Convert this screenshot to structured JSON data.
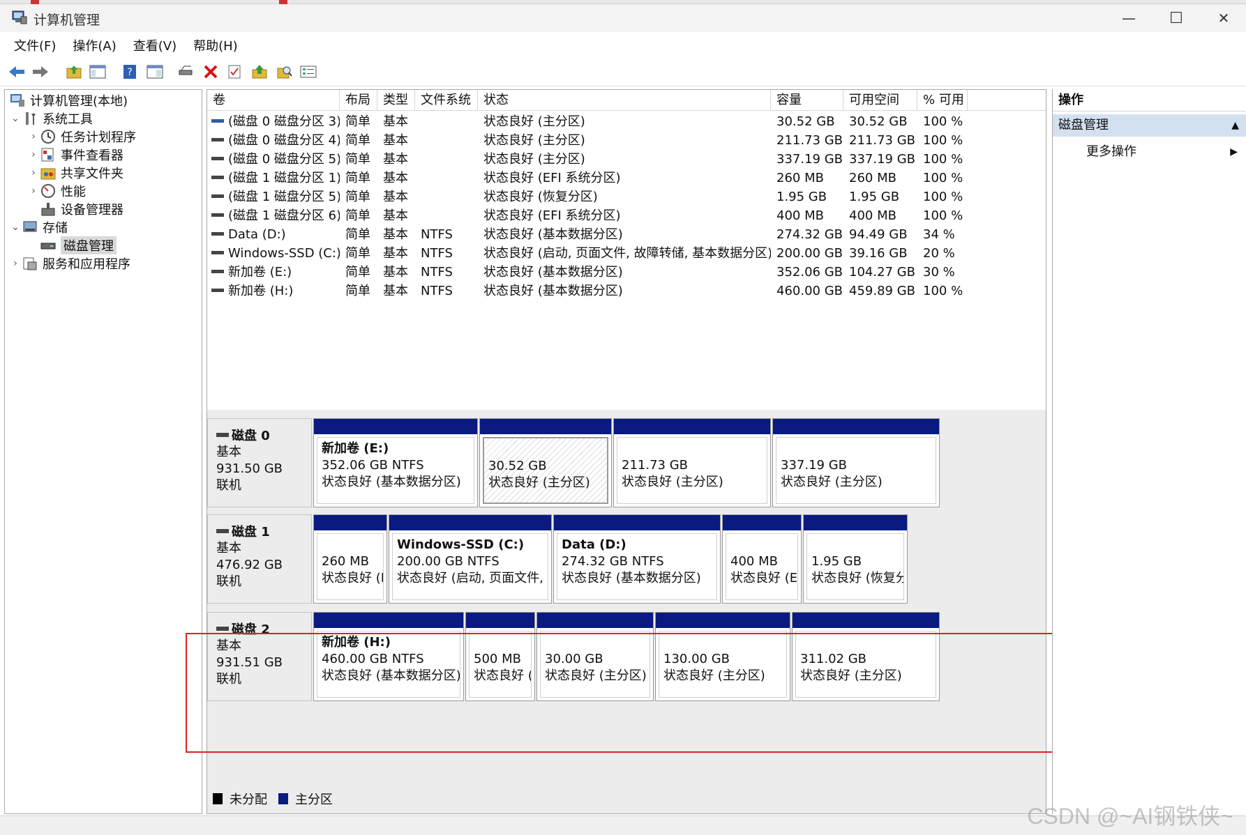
{
  "window": {
    "title": "计算机管理",
    "minimize": "—",
    "maximize": "☐",
    "close": "✕"
  },
  "menu": [
    "文件(F)",
    "操作(A)",
    "查看(V)",
    "帮助(H)"
  ],
  "tree": {
    "root": "计算机管理(本地)",
    "system_tools": "系统工具",
    "task_scheduler": "任务计划程序",
    "event_viewer": "事件查看器",
    "shared_folders": "共享文件夹",
    "performance": "性能",
    "device_manager": "设备管理器",
    "storage": "存储",
    "disk_management": "磁盘管理",
    "services_apps": "服务和应用程序"
  },
  "list": {
    "columns": [
      "卷",
      "布局",
      "类型",
      "文件系统",
      "状态",
      "容量",
      "可用空间",
      "% 可用"
    ],
    "rows": [
      {
        "vol": "(磁盘 0 磁盘分区 3)",
        "layout": "简单",
        "type": "基本",
        "fs": "",
        "status": "状态良好 (主分区)",
        "cap": "30.52 GB",
        "free": "30.52 GB",
        "pct": "100 %"
      },
      {
        "vol": "(磁盘 0 磁盘分区 4)",
        "layout": "简单",
        "type": "基本",
        "fs": "",
        "status": "状态良好 (主分区)",
        "cap": "211.73 GB",
        "free": "211.73 GB",
        "pct": "100 %"
      },
      {
        "vol": "(磁盘 0 磁盘分区 5)",
        "layout": "简单",
        "type": "基本",
        "fs": "",
        "status": "状态良好 (主分区)",
        "cap": "337.19 GB",
        "free": "337.19 GB",
        "pct": "100 %"
      },
      {
        "vol": "(磁盘 1 磁盘分区 1)",
        "layout": "简单",
        "type": "基本",
        "fs": "",
        "status": "状态良好 (EFI 系统分区)",
        "cap": "260 MB",
        "free": "260 MB",
        "pct": "100 %"
      },
      {
        "vol": "(磁盘 1 磁盘分区 5)",
        "layout": "简单",
        "type": "基本",
        "fs": "",
        "status": "状态良好 (恢复分区)",
        "cap": "1.95 GB",
        "free": "1.95 GB",
        "pct": "100 %"
      },
      {
        "vol": "(磁盘 1 磁盘分区 6)",
        "layout": "简单",
        "type": "基本",
        "fs": "",
        "status": "状态良好 (EFI 系统分区)",
        "cap": "400 MB",
        "free": "400 MB",
        "pct": "100 %"
      },
      {
        "vol": "Data (D:)",
        "layout": "简单",
        "type": "基本",
        "fs": "NTFS",
        "status": "状态良好 (基本数据分区)",
        "cap": "274.32 GB",
        "free": "94.49 GB",
        "pct": "34 %"
      },
      {
        "vol": "Windows-SSD (C:)",
        "layout": "简单",
        "type": "基本",
        "fs": "NTFS",
        "status": "状态良好 (启动, 页面文件, 故障转储, 基本数据分区)",
        "cap": "200.00 GB",
        "free": "39.16 GB",
        "pct": "20 %"
      },
      {
        "vol": "新加卷 (E:)",
        "layout": "简单",
        "type": "基本",
        "fs": "NTFS",
        "status": "状态良好 (基本数据分区)",
        "cap": "352.06 GB",
        "free": "104.27 GB",
        "pct": "30 %"
      },
      {
        "vol": "新加卷 (H:)",
        "layout": "简单",
        "type": "基本",
        "fs": "NTFS",
        "status": "状态良好 (基本数据分区)",
        "cap": "460.00 GB",
        "free": "459.89 GB",
        "pct": "100 %"
      }
    ]
  },
  "disks": [
    {
      "name": "磁盘 0",
      "type": "基本",
      "size": "931.50 GB",
      "state": "联机",
      "partitions": [
        {
          "name": "新加卷 (E:)",
          "line1": "352.06 GB NTFS",
          "line2": "状态良好 (基本数据分区)"
        },
        {
          "name": "",
          "line1": "30.52 GB",
          "line2": "状态良好 (主分区)"
        },
        {
          "name": "",
          "line1": "211.73 GB",
          "line2": "状态良好 (主分区)"
        },
        {
          "name": "",
          "line1": "337.19 GB",
          "line2": "状态良好 (主分区)"
        }
      ]
    },
    {
      "name": "磁盘 1",
      "type": "基本",
      "size": "476.92 GB",
      "state": "联机",
      "partitions": [
        {
          "name": "",
          "line1": "260 MB",
          "line2": "状态良好 (EF"
        },
        {
          "name": "Windows-SSD (C:)",
          "line1": "200.00 GB NTFS",
          "line2": "状态良好 (启动, 页面文件, 故障"
        },
        {
          "name": "Data (D:)",
          "line1": "274.32 GB NTFS",
          "line2": "状态良好 (基本数据分区)"
        },
        {
          "name": "",
          "line1": "400 MB",
          "line2": "状态良好 (EFI"
        },
        {
          "name": "",
          "line1": "1.95 GB",
          "line2": "状态良好 (恢复分区"
        }
      ]
    },
    {
      "name": "磁盘 2",
      "type": "基本",
      "size": "931.51 GB",
      "state": "联机",
      "partitions": [
        {
          "name": "新加卷 (H:)",
          "line1": "460.00 GB NTFS",
          "line2": "状态良好 (基本数据分区)"
        },
        {
          "name": "",
          "line1": "500 MB",
          "line2": "状态良好 (E"
        },
        {
          "name": "",
          "line1": "30.00 GB",
          "line2": "状态良好 (主分区)"
        },
        {
          "name": "",
          "line1": "130.00 GB",
          "line2": "状态良好 (主分区)"
        },
        {
          "name": "",
          "line1": "311.02 GB",
          "line2": "状态良好 (主分区)"
        }
      ]
    }
  ],
  "legend": {
    "unallocated": "未分配",
    "primary": "主分区",
    "unallocated_color": "#000000",
    "primary_color": "#0a1a80"
  },
  "actions": {
    "header": "操作",
    "section": "磁盘管理",
    "more": "更多操作"
  },
  "watermark": "CSDN @~AI钢铁侠~",
  "colors": {
    "partition_bar": "#0a1a80",
    "annotation": "#e02020",
    "actions_section_bg": "#d3e0ef"
  }
}
